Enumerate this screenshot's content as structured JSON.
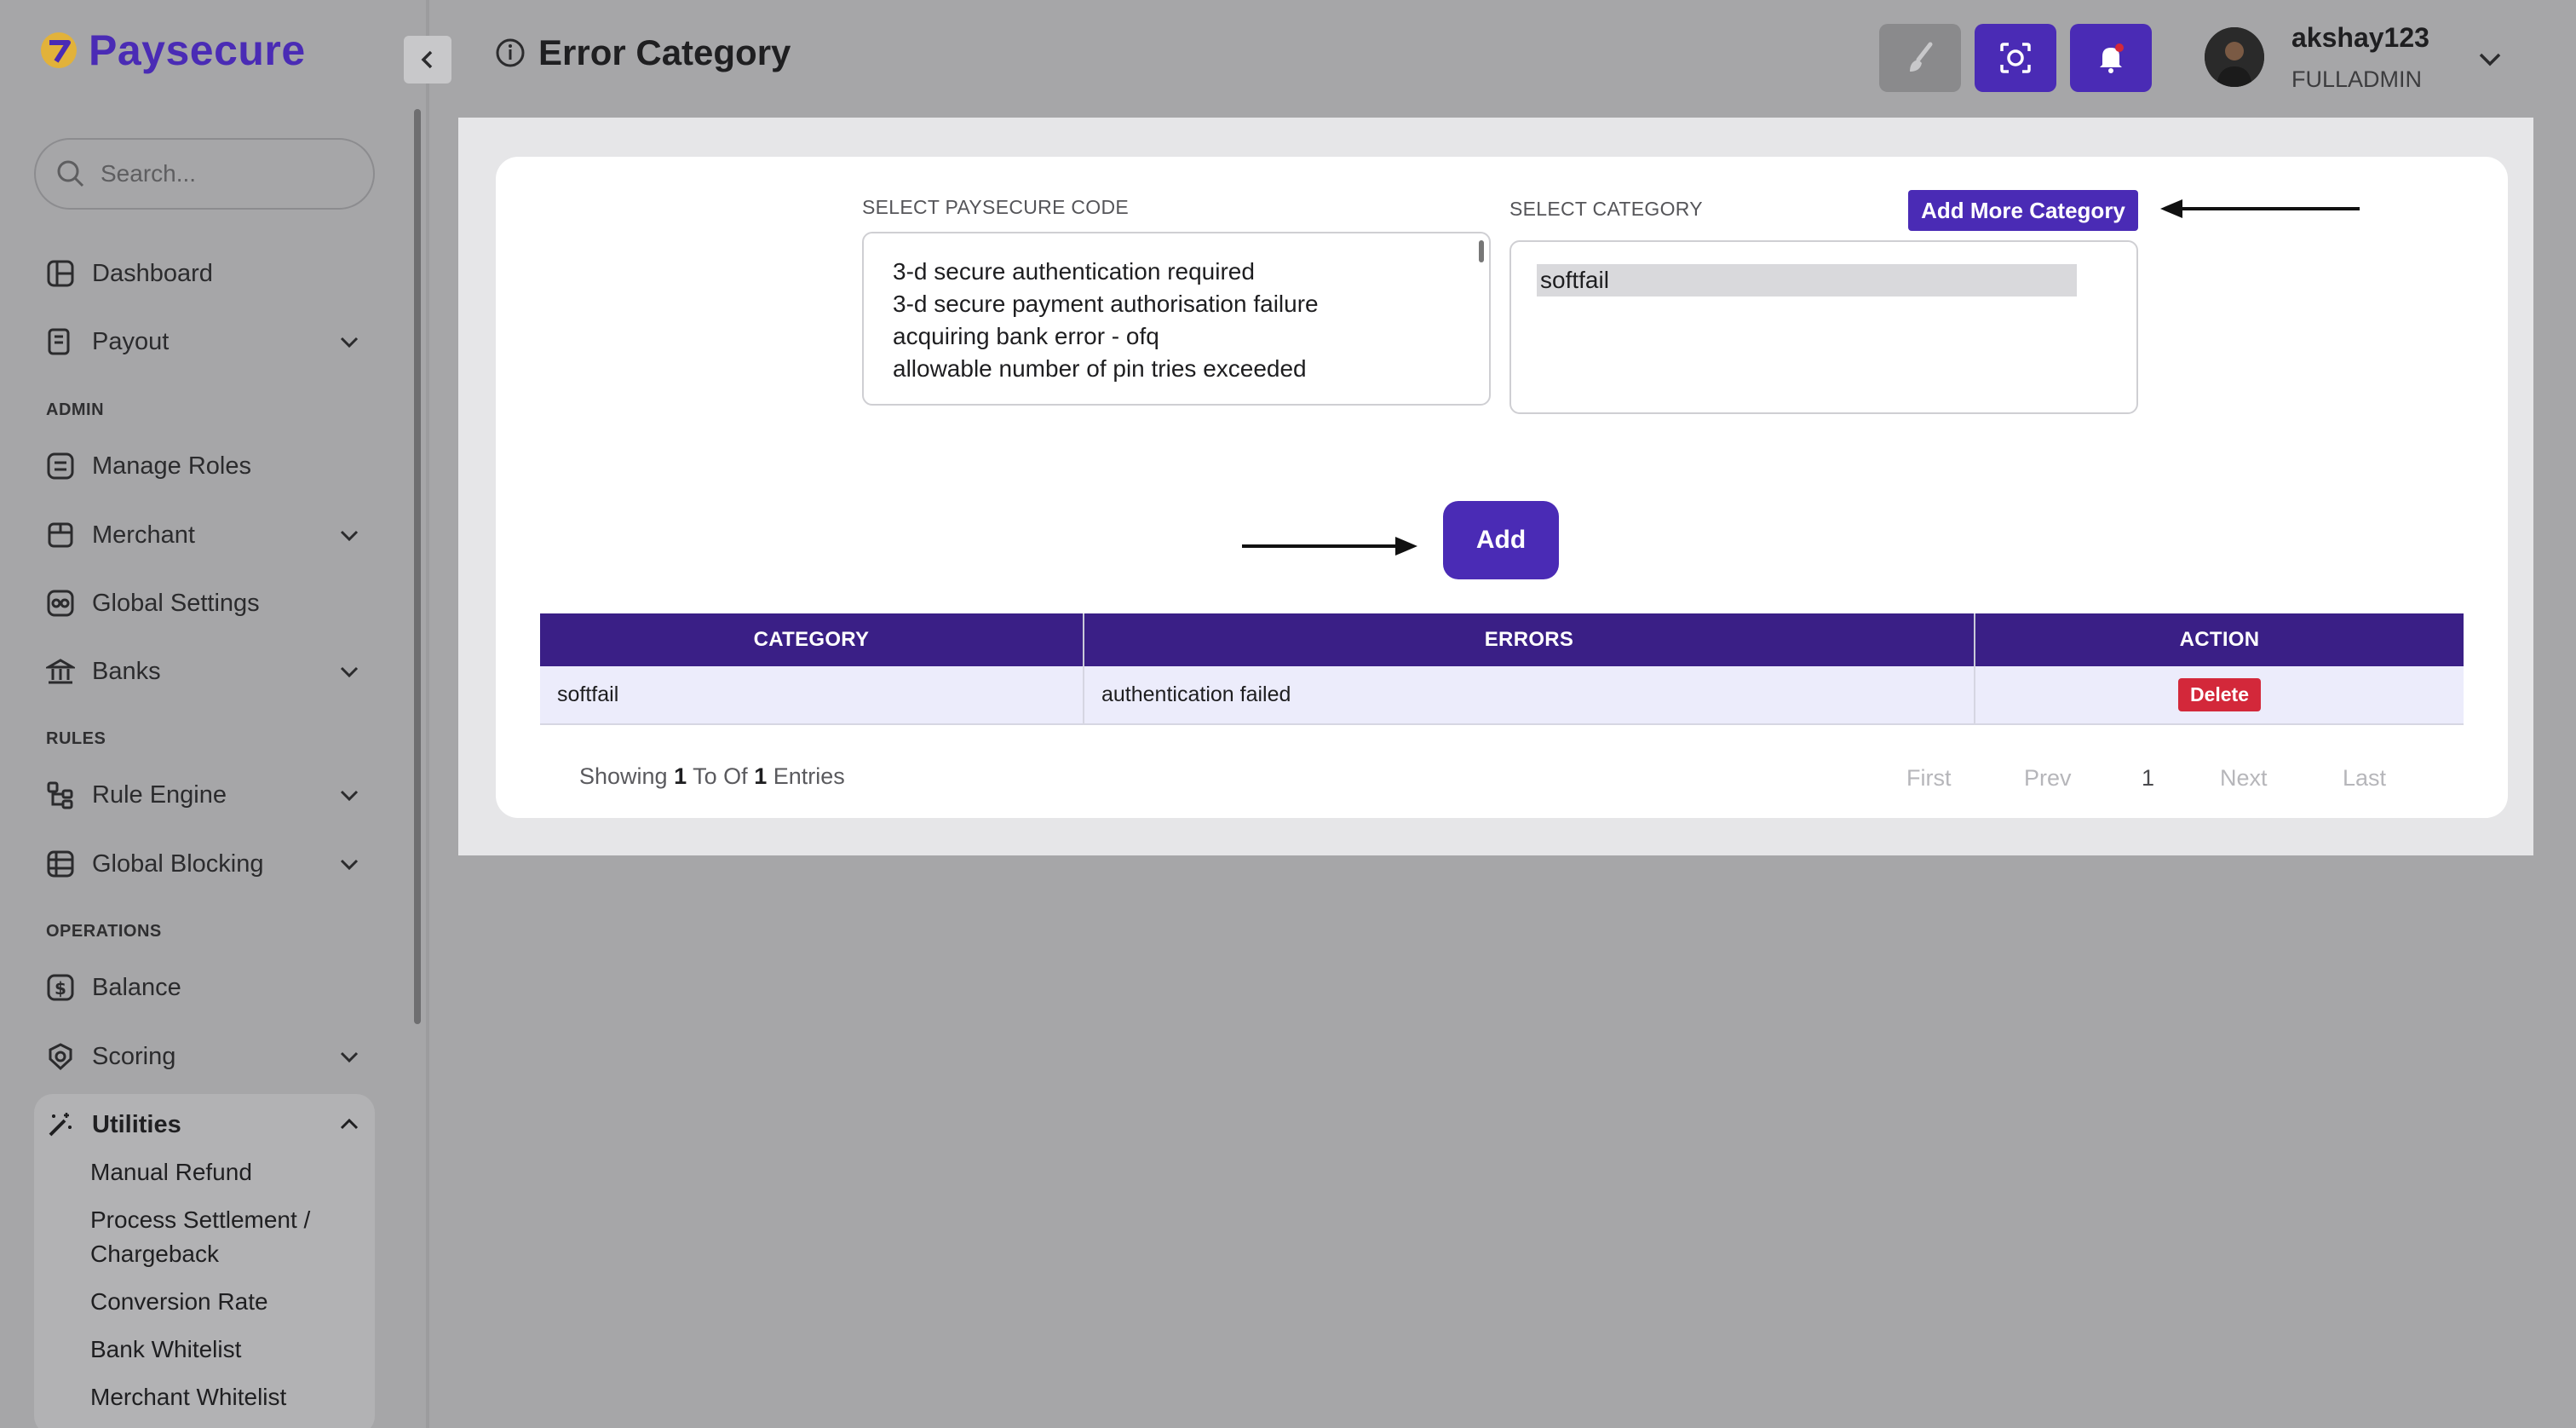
{
  "brand": {
    "name": "Paysecure"
  },
  "search": {
    "placeholder": "Search..."
  },
  "sidebar": {
    "items": [
      {
        "label": "Dashboard"
      },
      {
        "label": "Payout"
      },
      {
        "label": "Manage Roles"
      },
      {
        "label": "Merchant"
      },
      {
        "label": "Global Settings"
      },
      {
        "label": "Banks"
      },
      {
        "label": "Rule Engine"
      },
      {
        "label": "Global Blocking"
      },
      {
        "label": "Balance"
      },
      {
        "label": "Scoring"
      },
      {
        "label": "Utilities"
      }
    ],
    "sections": {
      "admin": "ADMIN",
      "rules": "RULES",
      "operations": "OPERATIONS"
    },
    "utilities_sub": [
      {
        "label": "Manual Refund"
      },
      {
        "label": "Process Settlement /"
      },
      {
        "label": "Chargeback"
      },
      {
        "label": "Conversion Rate"
      },
      {
        "label": "Bank Whitelist"
      },
      {
        "label": "Merchant Whitelist"
      }
    ]
  },
  "header": {
    "title": "Error Category",
    "user": {
      "name": "akshay123",
      "role": "FULLADMIN"
    }
  },
  "form": {
    "paysecure_code_label": "SELECT PAYSECURE CODE",
    "paysecure_codes": [
      "3-d secure authentication required",
      "3-d secure payment authorisation failure",
      "acquiring bank error - ofq",
      "allowable number of pin tries exceeded"
    ],
    "category_label": "SELECT CATEGORY",
    "categories": [
      "softfail"
    ],
    "add_more_label": "Add More Category",
    "add_label": "Add"
  },
  "table": {
    "headers": [
      "CATEGORY",
      "ERRORS",
      "ACTION"
    ],
    "rows": [
      {
        "category": "softfail",
        "errors": "authentication failed",
        "action": "Delete"
      }
    ]
  },
  "footer": {
    "showing_prefix": "Showing",
    "from": "1",
    "to_of": "To Of",
    "total": "1",
    "entries": "Entries"
  },
  "pagination": {
    "first": "First",
    "prev": "Prev",
    "current": "1",
    "next": "Next",
    "last": "Last"
  },
  "colors": {
    "brand": "#4a2bb5",
    "table_header": "#3a1f86",
    "danger": "#d3283a"
  }
}
